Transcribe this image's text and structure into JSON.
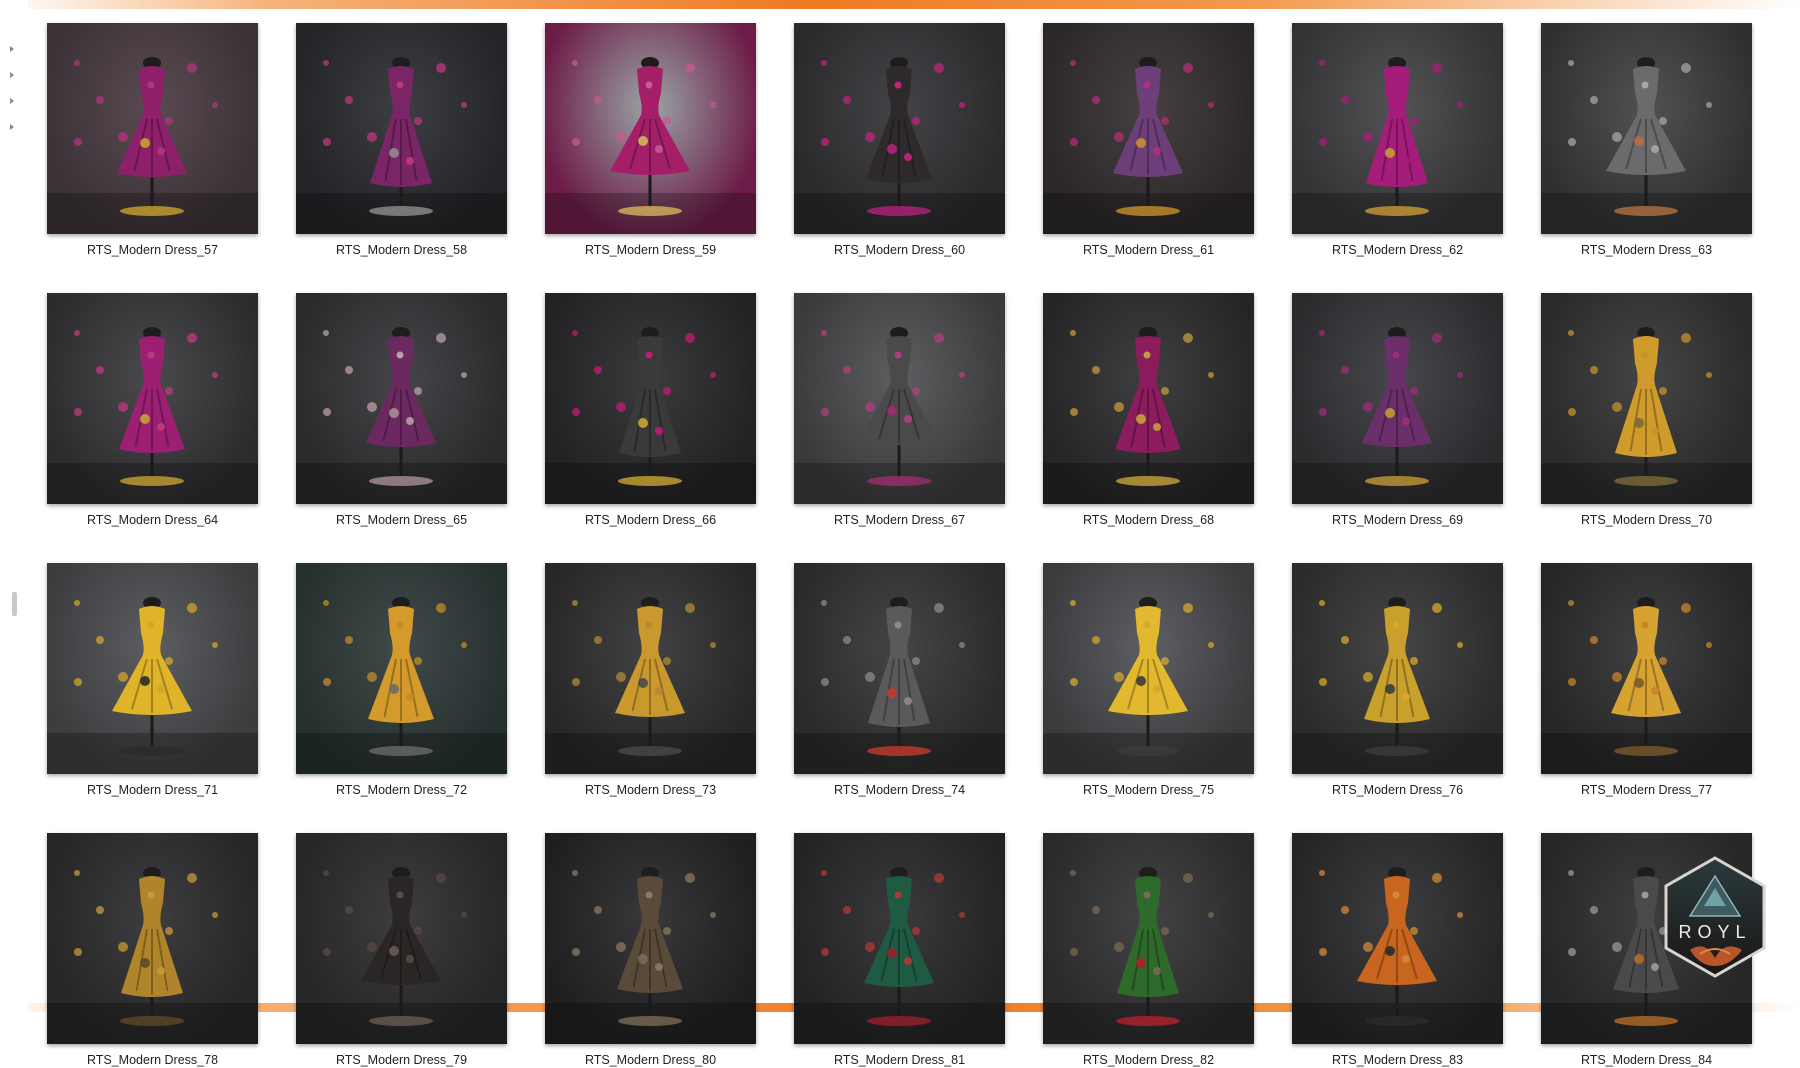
{
  "colors": {
    "accent": "#ee7a22",
    "label_text": "#222222",
    "page_bg": "#ffffff"
  },
  "gallery": {
    "items": [
      {
        "label": "RTS_Modern Dress_57",
        "bg": "#3a3236",
        "bg2": "#5a4a52",
        "dress": "#8e1f6b",
        "accent": "#c9a22a",
        "flowers": "#b0357e"
      },
      {
        "label": "RTS_Modern Dress_58",
        "bg": "#232427",
        "bg2": "#3d3e43",
        "dress": "#7a2565",
        "accent": "#8e8e8e",
        "flowers": "#c0377f"
      },
      {
        "label": "RTS_Modern Dress_59",
        "bg": "#6c1c47",
        "bg2": "#9aa5a6",
        "dress": "#a41f68",
        "accent": "#d6b35a",
        "flowers": "#c65a92"
      },
      {
        "label": "RTS_Modern Dress_60",
        "bg": "#2a2a2c",
        "bg2": "#444448",
        "dress": "#2e2a2c",
        "accent": "#b1227a",
        "flowers": "#c2237f"
      },
      {
        "label": "RTS_Modern Dress_61",
        "bg": "#2b2729",
        "bg2": "#46403f",
        "dress": "#6d3f7a",
        "accent": "#c7902c",
        "flowers": "#b32e7a"
      },
      {
        "label": "RTS_Modern Dress_62",
        "bg": "#333335",
        "bg2": "#535356",
        "dress": "#a51c7a",
        "accent": "#c99b35",
        "flowers": "#a51c7a"
      },
      {
        "label": "RTS_Modern Dress_63",
        "bg": "#2f3031",
        "bg2": "#505153",
        "dress": "#6b6b6d",
        "accent": "#b27040",
        "flowers": "#a6a6a4"
      },
      {
        "label": "RTS_Modern Dress_64",
        "bg": "#2c2c2e",
        "bg2": "#4a4a4d",
        "dress": "#9d1f73",
        "accent": "#c6a032",
        "flowers": "#c2387f"
      },
      {
        "label": "RTS_Modern Dress_65",
        "bg": "#2a2a2c",
        "bg2": "#46464a",
        "dress": "#6b2960",
        "accent": "#a79096",
        "flowers": "#b9a0aa"
      },
      {
        "label": "RTS_Modern Dress_66",
        "bg": "#222224",
        "bg2": "#3b3b3e",
        "dress": "#3b3a3b",
        "accent": "#c8a530",
        "flowers": "#c21b75"
      },
      {
        "label": "RTS_Modern Dress_67",
        "bg": "#3a3a3c",
        "bg2": "#5e5e61",
        "dress": "#4a4a4c",
        "accent": "#9c2e6a",
        "flowers": "#b23f7c"
      },
      {
        "label": "RTS_Modern Dress_68",
        "bg": "#252527",
        "bg2": "#3f3f42",
        "dress": "#8c1c5e",
        "accent": "#c6a23a",
        "flowers": "#c69b3a"
      },
      {
        "label": "RTS_Modern Dress_69",
        "bg": "#2b2b2e",
        "bg2": "#48484c",
        "dress": "#6a2f6a",
        "accent": "#c29a35",
        "flowers": "#a02b7a"
      },
      {
        "label": "RTS_Modern Dress_70",
        "bg": "#2a2a2b",
        "bg2": "#454546",
        "dress": "#cf9b2a",
        "accent": "#7a6a3a",
        "flowers": "#c8922a"
      },
      {
        "label": "RTS_Modern Dress_71",
        "bg": "#3c3d3f",
        "bg2": "#5c5d60",
        "dress": "#e0b429",
        "accent": "#2b2b2b",
        "flowers": "#d3a72c"
      },
      {
        "label": "RTS_Modern Dress_72",
        "bg": "#26302f",
        "bg2": "#3f4a49",
        "dress": "#d49b2c",
        "accent": "#6a6a6a",
        "flowers": "#c68b2a"
      },
      {
        "label": "RTS_Modern Dress_73",
        "bg": "#272728",
        "bg2": "#424244",
        "dress": "#c9992e",
        "accent": "#4a4a4a",
        "flowers": "#b38a33"
      },
      {
        "label": "RTS_Modern Dress_74",
        "bg": "#2a2a2b",
        "bg2": "#454547",
        "dress": "#5a5a5b",
        "accent": "#c43a2e",
        "flowers": "#8b8b8b"
      },
      {
        "label": "RTS_Modern Dress_75",
        "bg": "#3a3b3d",
        "bg2": "#5e5f62",
        "dress": "#e2b92e",
        "accent": "#3b3b3c",
        "flowers": "#d5aa2f"
      },
      {
        "label": "RTS_Modern Dress_76",
        "bg": "#2b2b2c",
        "bg2": "#464647",
        "dress": "#c9a02c",
        "accent": "#3b3b3c",
        "flowers": "#d9a82a"
      },
      {
        "label": "RTS_Modern Dress_77",
        "bg": "#262627",
        "bg2": "#404042",
        "dress": "#d6a232",
        "accent": "#7a5a2a",
        "flowers": "#c8862a"
      },
      {
        "label": "RTS_Modern Dress_78",
        "bg": "#262627",
        "bg2": "#3d3d3f",
        "dress": "#b0842a",
        "accent": "#5a4a2a",
        "flowers": "#c89a3a"
      },
      {
        "label": "RTS_Modern Dress_79",
        "bg": "#262627",
        "bg2": "#3d3d3f",
        "dress": "#2a2625",
        "accent": "#6a5a55",
        "flowers": "#5a4a45"
      },
      {
        "label": "RTS_Modern Dress_80",
        "bg": "#1f1f20",
        "bg2": "#38383a",
        "dress": "#5a4a3a",
        "accent": "#7a6a55",
        "flowers": "#8a7a60"
      },
      {
        "label": "RTS_Modern Dress_81",
        "bg": "#232324",
        "bg2": "#3a3a3c",
        "dress": "#1f5a43",
        "accent": "#9a1f2a",
        "flowers": "#b03a3a"
      },
      {
        "label": "RTS_Modern Dress_82",
        "bg": "#2a2a2b",
        "bg2": "#434345",
        "dress": "#2e6a2a",
        "accent": "#b51f2e",
        "flowers": "#7a6a55"
      },
      {
        "label": "RTS_Modern Dress_83",
        "bg": "#252526",
        "bg2": "#3d3d3f",
        "dress": "#c8661f",
        "accent": "#2b2b2b",
        "flowers": "#d18a35"
      },
      {
        "label": "RTS_Modern Dress_84",
        "bg": "#262627",
        "bg2": "#3e3e40",
        "dress": "#4a4a4b",
        "accent": "#b56a2a",
        "flowers": "#9a9a9a"
      }
    ]
  },
  "logo": {
    "text": "ROYL",
    "icon": "mountain-hexagon-logo"
  }
}
